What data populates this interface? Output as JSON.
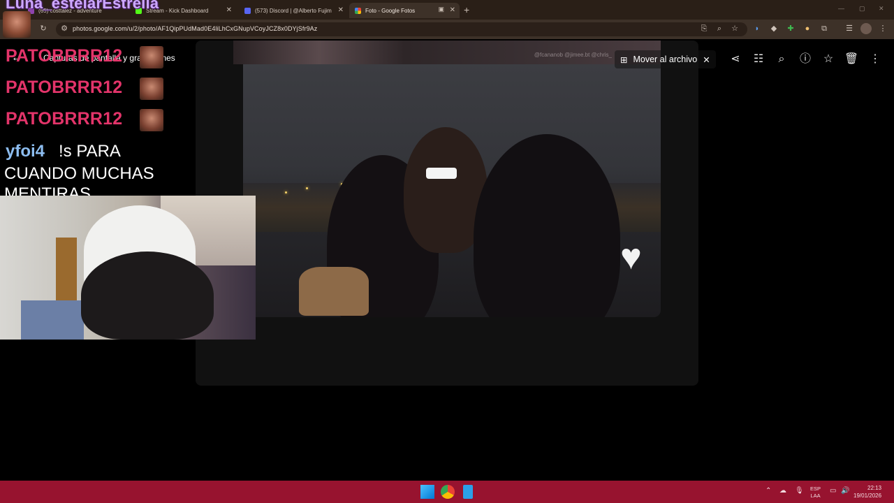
{
  "browser": {
    "tabs": [
      {
        "label": "(65) costtalez - adventure",
        "fav_color": "#8e44ad",
        "active": false
      },
      {
        "label": "Stream - Kick Dashboard",
        "fav_color": "#53fc18",
        "active": false
      },
      {
        "label": "(573) Discord | @Alberto Fujim",
        "fav_color": "#5865f2",
        "active": false
      },
      {
        "label": "Foto - Google Fotos",
        "fav_color": "#fbbc05",
        "active": true
      }
    ],
    "url": "photos.google.com/u/2/photo/AF1QipPUdMad0E4liLhCxGNupVCoyJCZ8x0DYjSfr9Az",
    "icons": [
      "reload-icon",
      "site-info-icon",
      "cast-icon",
      "zoom-icon",
      "bookmark-star-icon",
      "extension-icon",
      "profile-icon",
      "menu-icon"
    ]
  },
  "overlay": {
    "streamer_name": "Luna_estelarEstrella"
  },
  "photos": {
    "breadcrumb": "Capturas de pantalla y grabaciones",
    "archive_label": "Mover al archivo",
    "watermark": "@fcananob @jimee.bt @chris_",
    "toolbar_icons": [
      "share-icon",
      "edit-icon",
      "zoom-icon",
      "info-icon",
      "favorite-icon",
      "delete-icon",
      "more-icon"
    ]
  },
  "chat": {
    "messages": [
      {
        "user": "PATOBRRR12"
      },
      {
        "user": "PATOBRRR12"
      },
      {
        "user": "PATOBRRR12"
      }
    ],
    "last_user": "yfoi4",
    "last_msg_line1": "!s PARA",
    "last_msg_line2": "CUANDO MUCHAS",
    "last_msg_line3": "MENTIRAS"
  },
  "taskbar": {
    "lang_line1": "ESP",
    "lang_line2": "LAA",
    "time": "22:13",
    "date": "19/01/2026",
    "accent": "#97132f"
  }
}
